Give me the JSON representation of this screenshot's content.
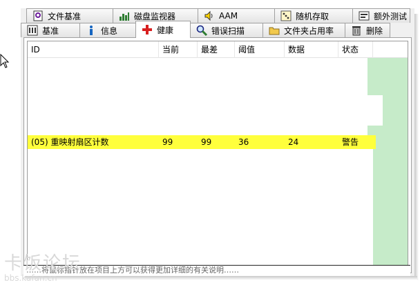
{
  "tabs_row1": [
    {
      "label": "文件基准",
      "icon": "file-benchmark-icon"
    },
    {
      "label": "磁盘监视器",
      "icon": "disk-monitor-icon"
    },
    {
      "label": "AAM",
      "icon": "speaker-icon"
    },
    {
      "label": "随机存取",
      "icon": "random-access-icon"
    },
    {
      "label": "额外测试",
      "icon": "extra-tests-icon"
    }
  ],
  "tabs_row2": [
    {
      "label": "基准",
      "icon": "benchmark-icon"
    },
    {
      "label": "信息",
      "icon": "info-icon"
    },
    {
      "label": "健康",
      "icon": "health-cross-icon"
    },
    {
      "label": "错误扫描",
      "icon": "error-scan-icon"
    },
    {
      "label": "文件夹占用率",
      "icon": "folder-usage-icon"
    },
    {
      "label": "删除",
      "icon": "delete-icon"
    }
  ],
  "active_tab": "健康",
  "table": {
    "columns": [
      "ID",
      "当前",
      "最差",
      "阈值",
      "数据",
      "状态"
    ],
    "highlighted_row": [
      "(05) 重映射扇区计数",
      "99",
      "99",
      "36",
      "24",
      "警告"
    ]
  },
  "colors": {
    "highlight": "#ffff3c",
    "status_green": "#c6ebc9",
    "health_red": "#d81f1f"
  },
  "watermark": {
    "big": "卡饭论坛",
    "small": "bbs.kafan.cn"
  },
  "statusbar_text": "……将鼠标指针放在项目上方可以获得更加详细的有关说明……"
}
